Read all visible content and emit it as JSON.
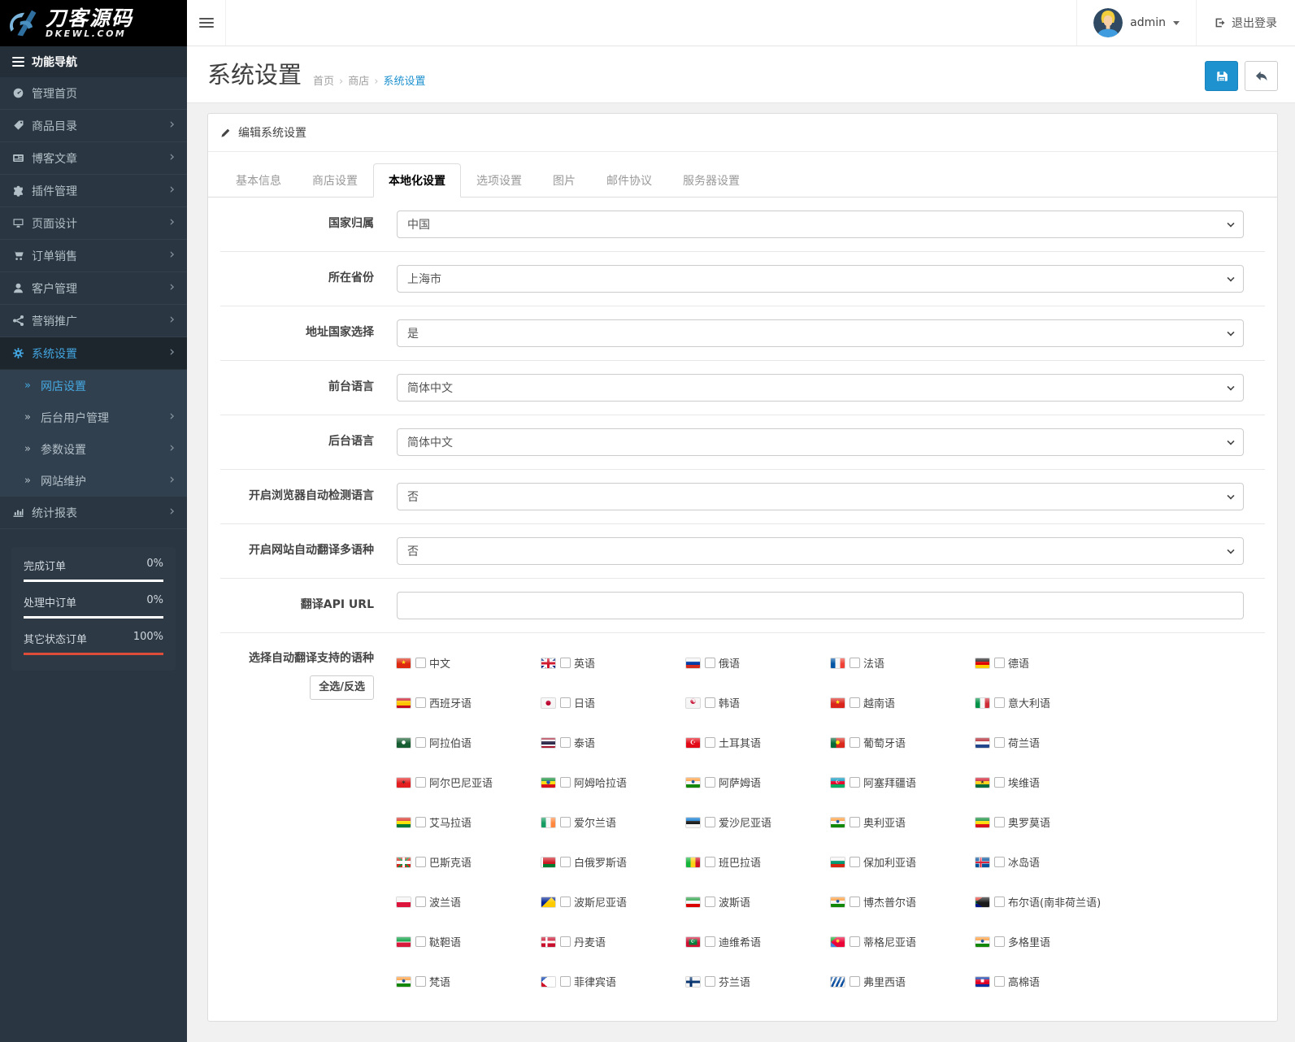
{
  "brand": {
    "title": "刀客源码",
    "domain": "DKEWL.COM"
  },
  "topbar": {
    "user_name": "admin",
    "logout_label": "退出登录"
  },
  "sidebar": {
    "nav_header": "功能导航",
    "items": [
      {
        "key": "dashboard",
        "icon": "dashboard",
        "label": "管理首页",
        "chevron": false,
        "active": false
      },
      {
        "key": "catalog",
        "icon": "tag",
        "label": "商品目录",
        "chevron": true,
        "active": false
      },
      {
        "key": "blog",
        "icon": "news",
        "label": "博客文章",
        "chevron": true,
        "active": false
      },
      {
        "key": "extensions",
        "icon": "puzzle",
        "label": "插件管理",
        "chevron": true,
        "active": false
      },
      {
        "key": "design",
        "icon": "monitor",
        "label": "页面设计",
        "chevron": true,
        "active": false
      },
      {
        "key": "sales",
        "icon": "cart",
        "label": "订单销售",
        "chevron": true,
        "active": false
      },
      {
        "key": "customers",
        "icon": "user",
        "label": "客户管理",
        "chevron": true,
        "active": false
      },
      {
        "key": "marketing",
        "icon": "share",
        "label": "营销推广",
        "chevron": true,
        "active": false
      },
      {
        "key": "system",
        "icon": "gear",
        "label": "系统设置",
        "chevron": true,
        "active": true
      },
      {
        "key": "store-settings",
        "sub": true,
        "label": "网店设置",
        "chevron": false,
        "active": true
      },
      {
        "key": "admin-users",
        "sub": true,
        "label": "后台用户管理",
        "chevron": true,
        "active": false
      },
      {
        "key": "parameters",
        "sub": true,
        "label": "参数设置",
        "chevron": true,
        "active": false
      },
      {
        "key": "maintenance",
        "sub": true,
        "label": "网站维护",
        "chevron": true,
        "active": false
      },
      {
        "key": "reports",
        "icon": "chart",
        "label": "统计报表",
        "chevron": true,
        "active": false
      }
    ],
    "stats": [
      {
        "label": "完成订单",
        "value": "0%",
        "pct": 0
      },
      {
        "label": "处理中订单",
        "value": "0%",
        "pct": 0
      },
      {
        "label": "其它状态订单",
        "value": "100%",
        "pct": 100
      }
    ]
  },
  "page": {
    "title": "系统设置",
    "breadcrumbs": [
      "首页",
      "商店",
      "系统设置"
    ],
    "breadcrumb_separator": "›"
  },
  "panel": {
    "heading": "编辑系统设置",
    "tabs": [
      {
        "key": "basic",
        "label": "基本信息",
        "active": false
      },
      {
        "key": "store",
        "label": "商店设置",
        "active": false
      },
      {
        "key": "local",
        "label": "本地化设置",
        "active": true
      },
      {
        "key": "option",
        "label": "选项设置",
        "active": false
      },
      {
        "key": "image",
        "label": "图片",
        "active": false
      },
      {
        "key": "mail",
        "label": "邮件协议",
        "active": false
      },
      {
        "key": "server",
        "label": "服务器设置",
        "active": false
      }
    ],
    "fields": [
      {
        "key": "country",
        "label": "国家归属",
        "type": "select",
        "value": "中国"
      },
      {
        "key": "zone",
        "label": "所在省份",
        "type": "select",
        "value": "上海市"
      },
      {
        "key": "address-country",
        "label": "地址国家选择",
        "type": "select",
        "value": "是"
      },
      {
        "key": "frontend-language",
        "label": "前台语言",
        "type": "select",
        "value": "简体中文"
      },
      {
        "key": "admin-language",
        "label": "后台语言",
        "type": "select",
        "value": "简体中文"
      },
      {
        "key": "browser-detect-language",
        "label": "开启浏览器自动检测语言",
        "type": "select",
        "value": "否"
      },
      {
        "key": "auto-translate",
        "label": "开启网站自动翻译多语种",
        "type": "select",
        "value": "否"
      },
      {
        "key": "translate-api-url",
        "label": "翻译API URL",
        "type": "text",
        "value": "",
        "placeholder": ""
      }
    ],
    "languages": {
      "label": "选择自动翻译支持的语种",
      "toggle_all": "全选/反选",
      "items": [
        {
          "n": "中文",
          "f": "#de2910",
          "g": "★",
          "c": "#ffde00",
          "s": 7
        },
        {
          "n": "英语",
          "f": "linear-gradient(90deg,transparent 41%,#cf142b 41% 59%,transparent 59%),linear-gradient(0deg,transparent 36%,#cf142b 36% 64%,transparent 64%),linear-gradient(90deg,transparent 33%,#ffffff 33% 67%,transparent 67%),linear-gradient(0deg,transparent 27%,#ffffff 27% 73%,transparent 73%),linear-gradient(45deg,transparent 44%,#ffffff 44% 56%,transparent 56%),linear-gradient(135deg,transparent 44%,#ffffff 44% 56%,transparent 56%),#00247d"
        },
        {
          "n": "俄语",
          "f": "linear-gradient(180deg,#f5f5f5 0 33%,#0039a6 33% 67%,#d52b1e 67%)"
        },
        {
          "n": "法语",
          "f": "linear-gradient(90deg,#0055a4 0 33%,#f5f5f5 33% 67%,#ef4135 67%)"
        },
        {
          "n": "德语",
          "f": "linear-gradient(180deg,#1a1a1a 0 33%,#dd0000 33% 67%,#ffce00 67%)"
        },
        {
          "n": "西班牙语",
          "f": "linear-gradient(180deg,#c60b1e 0 25%,#ffc400 25% 75%,#c60b1e 75%)"
        },
        {
          "n": "日语",
          "f": "#f5f5f5",
          "g": "●",
          "c": "#bc002d",
          "s": 8
        },
        {
          "n": "韩语",
          "f": "#f5f5f5",
          "g": "☯",
          "c": "#c60c30",
          "s": 9
        },
        {
          "n": "越南语",
          "f": "#da251d",
          "g": "★",
          "c": "#ffef00",
          "s": 7
        },
        {
          "n": "意大利语",
          "f": "linear-gradient(90deg,#009246 0 33%,#f5f5f5 33% 67%,#ce2b37 67%)"
        },
        {
          "n": "阿拉伯语",
          "f": "#165d31",
          "g": "●",
          "c": "#ffffff",
          "s": 6
        },
        {
          "n": "泰语",
          "f": "linear-gradient(180deg,#a51931 0 17%,#f4f5f8 17% 34%,#2d2a4a 34% 66%,#f4f5f8 66% 83%,#a51931 83%)"
        },
        {
          "n": "土耳其语",
          "f": "#e30a17",
          "g": "☪",
          "c": "#ffffff",
          "s": 8
        },
        {
          "n": "葡萄牙语",
          "f": "linear-gradient(90deg,#046a38 0 38%,#da291c 38%)",
          "g": "●",
          "c": "#ffe900",
          "s": 6
        },
        {
          "n": "荷兰语",
          "f": "linear-gradient(180deg,#ae1c28 0 33%,#f5f5f5 33% 67%,#21468b 67%)"
        },
        {
          "n": "阿尔巴尼亚语",
          "f": "#e41e20",
          "g": "✶",
          "c": "#26211f",
          "s": 8
        },
        {
          "n": "阿姆哈拉语",
          "f": "linear-gradient(180deg,#078930 0 33%,#fcdd09 33% 67%,#da121a 67%)",
          "g": "●",
          "c": "#0f47af",
          "s": 6
        },
        {
          "n": "阿萨姆语",
          "f": "linear-gradient(180deg,#ff9933 0 33%,#f5f5f5 33% 67%,#138808 67%)",
          "g": "●",
          "c": "#054187",
          "s": 5
        },
        {
          "n": "阿塞拜疆语",
          "f": "linear-gradient(180deg,#0092bc 0 33%,#e4002b 33% 67%,#00ae65 67%)",
          "g": "☪",
          "c": "#ffffff",
          "s": 6
        },
        {
          "n": "埃维语",
          "f": "linear-gradient(180deg,#ce1126 0 33%,#fcd116 33% 67%,#006b3f 67%)",
          "g": "★",
          "c": "#1a1a1a",
          "s": 6
        },
        {
          "n": "艾马拉语",
          "f": "linear-gradient(180deg,#d52b1e 0 33%,#f9e300 33% 67%,#007934 67%)"
        },
        {
          "n": "爱尔兰语",
          "f": "linear-gradient(90deg,#169b62 0 33%,#f5f5f5 33% 67%,#ff883e 67%)"
        },
        {
          "n": "爱沙尼亚语",
          "f": "linear-gradient(180deg,#0072ce 0 33%,#1a1a1a 33% 67%,#f5f5f5 67%)"
        },
        {
          "n": "奥利亚语",
          "f": "linear-gradient(180deg,#ff9933 0 33%,#f5f5f5 33% 67%,#138808 67%)",
          "g": "●",
          "c": "#054187",
          "s": 5
        },
        {
          "n": "奥罗莫语",
          "f": "linear-gradient(180deg,#078930 0 33%,#fcdd09 33% 67%,#da121a 67%)"
        },
        {
          "n": "巴斯克语",
          "f": "linear-gradient(90deg,transparent 42%,#ffffff 42% 58%,transparent 58%),linear-gradient(0deg,transparent 34%,#ffffff 34% 66%,transparent 66%),linear-gradient(45deg,transparent 45%,#009b48 45% 55%,transparent 55%),linear-gradient(135deg,transparent 45%,#009b48 45% 55%,transparent 55%),#d52b1e"
        },
        {
          "n": "白俄罗斯语",
          "f": "linear-gradient(90deg,#ffffff 0 13%,transparent 13%),linear-gradient(180deg,#ce1720 0 66%,#007c30 66%)"
        },
        {
          "n": "班巴拉语",
          "f": "linear-gradient(90deg,#14b53a 0 33%,#fcd116 33% 67%,#ce1126 67%)"
        },
        {
          "n": "保加利亚语",
          "f": "linear-gradient(180deg,#f5f5f5 0 33%,#00966e 33% 67%,#d62612 67%)"
        },
        {
          "n": "冰岛语",
          "f": "linear-gradient(90deg,transparent 31%,#dc1e35 31% 43%,transparent 43%),linear-gradient(0deg,transparent 43%,#dc1e35 43% 57%,transparent 57%),linear-gradient(90deg,transparent 26%,#ffffff 26% 48%,transparent 48%),linear-gradient(0deg,transparent 36%,#ffffff 36% 64%,transparent 64%),#02529c"
        },
        {
          "n": "波兰语",
          "f": "linear-gradient(180deg,#f5f5f5 0 50%,#dc143c 50%)"
        },
        {
          "n": "波斯尼亚语",
          "f": "conic-gradient(from 135deg at 72% 0%,#fecb00 0 90deg,transparent 90deg),#002395"
        },
        {
          "n": "波斯语",
          "f": "linear-gradient(180deg,#239f40 0 33%,#f5f5f5 33% 67%,#da0000 67%)"
        },
        {
          "n": "博杰普尔语",
          "f": "linear-gradient(180deg,#ff9933 0 33%,#f5f5f5 33% 67%,#138808 67%)",
          "g": "●",
          "c": "#054187",
          "s": 5
        },
        {
          "n": "布尔语(南非荷兰语)",
          "f": "conic-gradient(from 55deg at 0% 50%,#1a1a1a 0 70deg,transparent 70deg),linear-gradient(0deg,transparent 33%,#007749 33% 67%,transparent 67%),linear-gradient(180deg,#e03c31 0 50%,#001489 50%)"
        },
        {
          "n": "鞑靼语",
          "f": "linear-gradient(180deg,#009b3a 0 44%,#ffffff 44% 56%,#d81a3c 56%)"
        },
        {
          "n": "丹麦语",
          "f": "linear-gradient(90deg,transparent 28%,#ffffff 28% 44%,transparent 44%),linear-gradient(0deg,transparent 38%,#ffffff 38% 62%,transparent 62%),#c8102e"
        },
        {
          "n": "迪维希语",
          "f": "linear-gradient(90deg,#d21034 0 20%,transparent 20% 80%,#d21034 80%),linear-gradient(180deg,#d21034 0 20%,#007e3a 20% 80%,#d21034 80%)",
          "g": "☪",
          "c": "#ffffff",
          "s": 6
        },
        {
          "n": "蒂格尼亚语",
          "f": "conic-gradient(from 50deg at 0% 50%,#ea0437 0 80deg,transparent 80deg),linear-gradient(180deg,#12ad2b 0 50%,#4189dd 50%)",
          "g": "●",
          "c": "#ffc726",
          "s": 5
        },
        {
          "n": "多格里语",
          "f": "linear-gradient(180deg,#ff9933 0 33%,#f5f5f5 33% 67%,#138808 67%)",
          "g": "●",
          "c": "#054187",
          "s": 5
        },
        {
          "n": "梵语",
          "f": "linear-gradient(180deg,#ff9933 0 33%,#f5f5f5 33% 67%,#138808 67%)",
          "g": "●",
          "c": "#054187",
          "s": 5
        },
        {
          "n": "菲律宾语",
          "f": "conic-gradient(from 50deg at 0% 50%,#ffffff 0 80deg,transparent 80deg),linear-gradient(180deg,#0038a8 0 50%,#ce1126 50%)"
        },
        {
          "n": "芬兰语",
          "f": "linear-gradient(90deg,transparent 27%,#002f6c 27% 45%,transparent 45%),linear-gradient(0deg,transparent 37%,#002f6c 37% 63%,transparent 63%),#f5f5f5"
        },
        {
          "n": "弗里西语",
          "f": "repeating-linear-gradient(115deg,#0a4fa0 0 2.5px,#f5f5f5 2.5px 5px)"
        },
        {
          "n": "高棉语",
          "f": "linear-gradient(180deg,#032ea1 0 27%,#e00025 27% 73%,#032ea1 73%)",
          "g": "■",
          "c": "#ffffff",
          "s": 5
        }
      ]
    }
  },
  "colors": {
    "accent": "#1e91cf",
    "accent_light": "#42a5e0",
    "danger": "#dd4b39",
    "sidebar_bg": "#2a3642",
    "sidebar_sub_bg": "#30404f",
    "sidebar_active_bg": "#1d262d",
    "content_bg": "#f1f1f1",
    "panel_border": "#dddddd",
    "logo_bg": "#000000",
    "stats_bg": "#2e3946",
    "bar_track": "#ffffff"
  }
}
